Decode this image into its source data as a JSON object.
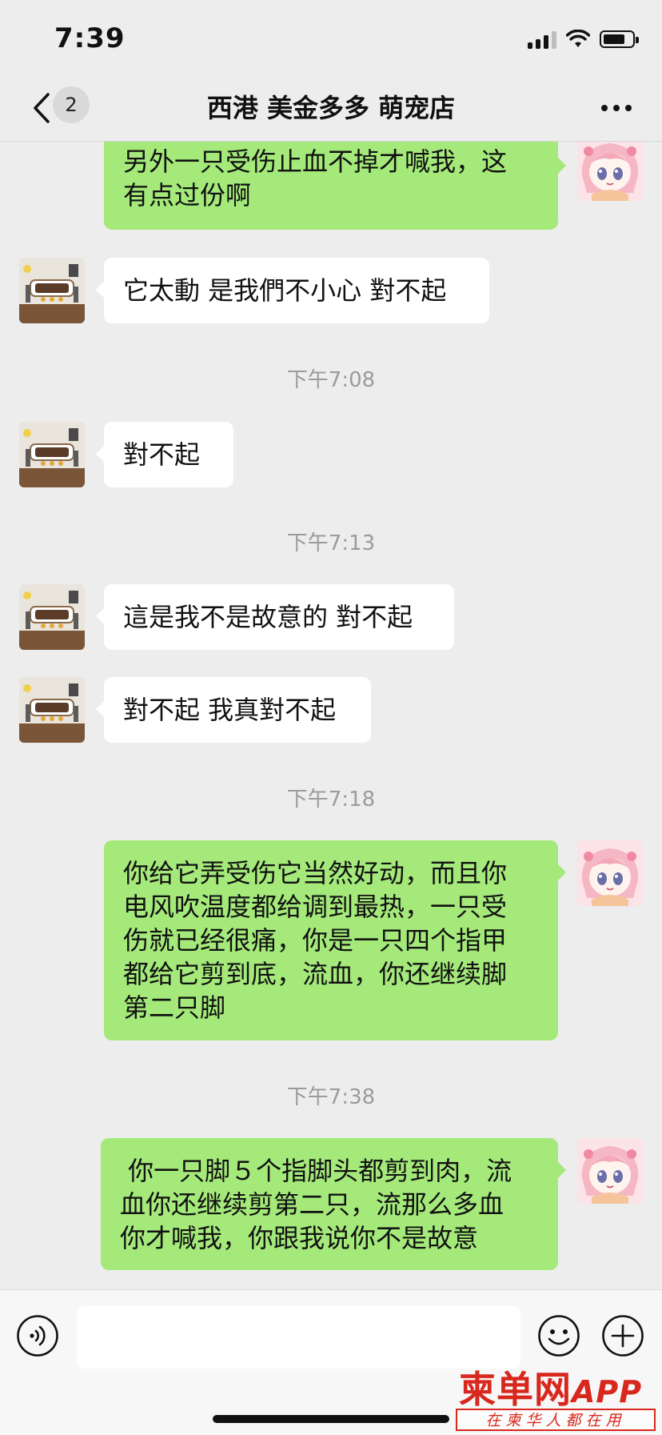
{
  "status_bar": {
    "time": "7:39"
  },
  "header": {
    "title": "西港 美金多多 萌宠店",
    "unread_count": "2"
  },
  "messages": [
    {
      "side": "out",
      "text_lines": [
        "另外一只受伤止血不掉才喊我，这",
        "有点过份啊"
      ]
    },
    {
      "side": "in",
      "text": "它太動 是我們不小心 對不起"
    },
    {
      "timestamp": "下午7:08"
    },
    {
      "side": "in",
      "text": "對不起"
    },
    {
      "timestamp": "下午7:13"
    },
    {
      "side": "in",
      "text": "這是我不是故意的 對不起"
    },
    {
      "side": "in",
      "text": "對不起 我真對不起"
    },
    {
      "timestamp": "下午7:18"
    },
    {
      "side": "out",
      "text_lines": [
        "你给它弄受伤它当然好动，而且你",
        "电风吹温度都给调到最热，一只受",
        "伤就已经很痛，你是一只四个指甲",
        "都给它剪到底，流血，你还继续脚",
        "第二只脚"
      ]
    },
    {
      "timestamp": "下午7:38"
    },
    {
      "side": "out",
      "text_lines": [
        " 你一只脚５个指脚头都剪到肉，流",
        "血你还继续剪第二只，流那么多血",
        "你才喊我，你跟我说你不是故意"
      ]
    }
  ],
  "watermark": {
    "logo": "柬单网",
    "logo_suffix": "APP",
    "slogan": "在柬华人都在用"
  },
  "colors": {
    "background": "#ededed",
    "outgoing_bubble": "#a4e97a",
    "incoming_bubble": "#ffffff",
    "timestamp_text": "#9b9b9b",
    "watermark_red": "#d8281e"
  },
  "icons": [
    "back-chevron-icon",
    "more-icon",
    "voice-icon",
    "emoji-icon",
    "plus-icon",
    "signal-icon",
    "wifi-icon",
    "battery-icon"
  ]
}
